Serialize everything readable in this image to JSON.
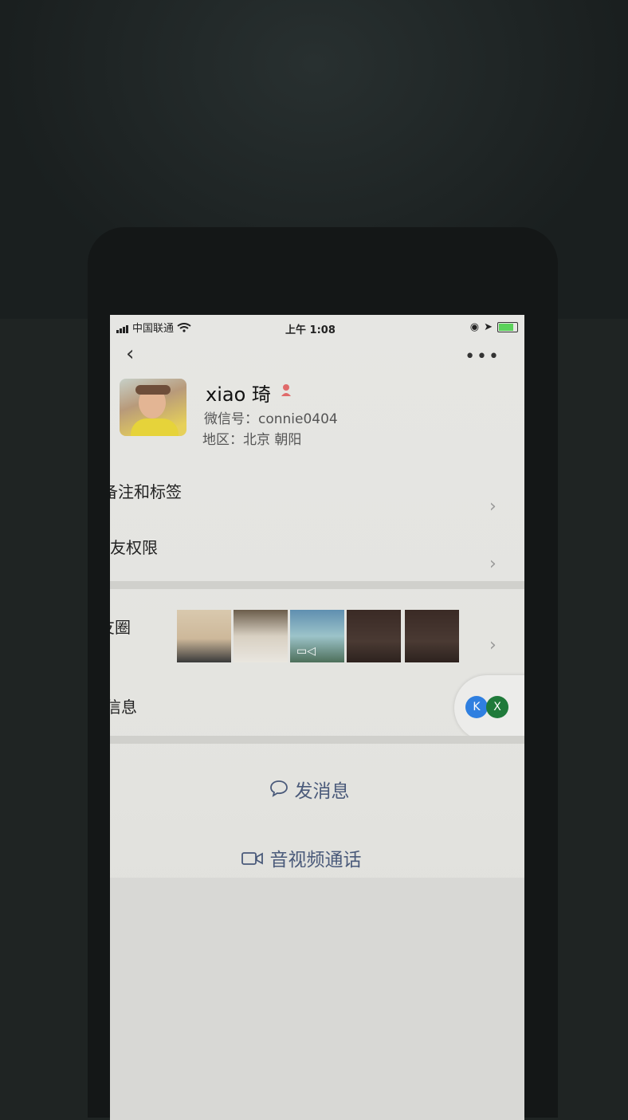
{
  "status_bar": {
    "carrier": "中国联通",
    "time": "上午 1:08"
  },
  "profile": {
    "name": "xiao 琦",
    "wechat_id": "微信号：connie0404",
    "region": "地区：北京 朝阳"
  },
  "menu": {
    "remarks_tags": "备注和标签",
    "friend_permissions": "朋友权限",
    "moments": "朋友圈",
    "more_info": "更多信息"
  },
  "actions": {
    "send_message": "发消息",
    "av_call": "音视频通话"
  },
  "floating": {
    "badge_a": "K",
    "badge_b": "X"
  },
  "colors": {
    "action_text": "#4a5a7a",
    "gender_icon": "#e06a6a",
    "battery": "#5bd25b"
  }
}
